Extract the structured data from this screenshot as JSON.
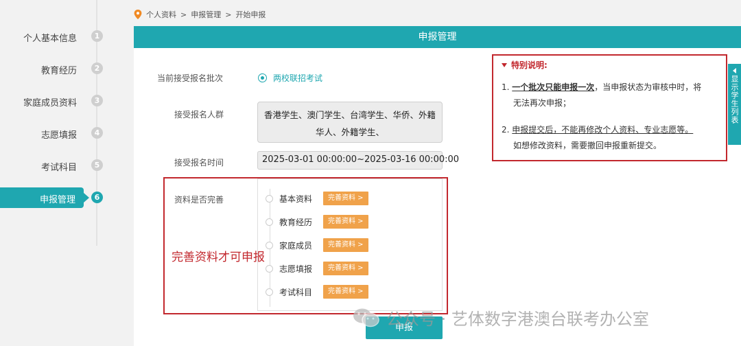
{
  "breadcrumb": [
    "个人资料",
    ">",
    "申报管理",
    ">",
    "开始申报"
  ],
  "sidebar": {
    "items": [
      {
        "label": "个人基本信息",
        "num": "1"
      },
      {
        "label": "教育经历",
        "num": "2"
      },
      {
        "label": "家庭成员资料",
        "num": "3"
      },
      {
        "label": "志愿填报",
        "num": "4"
      },
      {
        "label": "考试科目",
        "num": "5"
      },
      {
        "label": "申报管理",
        "num": "6"
      }
    ]
  },
  "panel": {
    "title": "申报管理",
    "batch_label": "当前接受报名批次",
    "batch_value": "两校联招考试",
    "group_label": "接受报名人群",
    "group_value": "香港学生、澳门学生、台湾学生、华侨、外籍华人、外籍学生、",
    "time_label": "接受报名时间",
    "time_value": "2025-03-01 00:00:00~2025-03-16 00:00:00",
    "complete_label": "资料是否完善",
    "complete_items": [
      {
        "name": "基本资料",
        "button": "完善资料 >"
      },
      {
        "name": "教育经历",
        "button": "完善资料 >"
      },
      {
        "name": "家庭成员",
        "button": "完善资料 >"
      },
      {
        "name": "志愿填报",
        "button": "完善资料 >"
      },
      {
        "name": "考试科目",
        "button": "完善资料 >"
      }
    ],
    "annotation": "完善资料才可申报",
    "submit_label": "申报"
  },
  "notice": {
    "title": "特别说明:",
    "item1_num": "1.",
    "item1_underline": "一个批次只能申报一次",
    "item1_rest_line1": "，当申报状态为审核中时，将",
    "item1_line2": "无法再次申报；",
    "item2_num": "2.",
    "item2_underline": "申报提交后，不能再修改个人资料、专业志愿等。",
    "item2_line2": "如想修改资料，需要撤回申报重新提交。"
  },
  "side_tab": "显示学生列表",
  "watermark": "公众号 · 艺体数字港澳台联考办公室",
  "colors": {
    "primary": "#1fa7b0",
    "button_orange": "#f0a24a",
    "annotation_red": "#c2272d"
  }
}
